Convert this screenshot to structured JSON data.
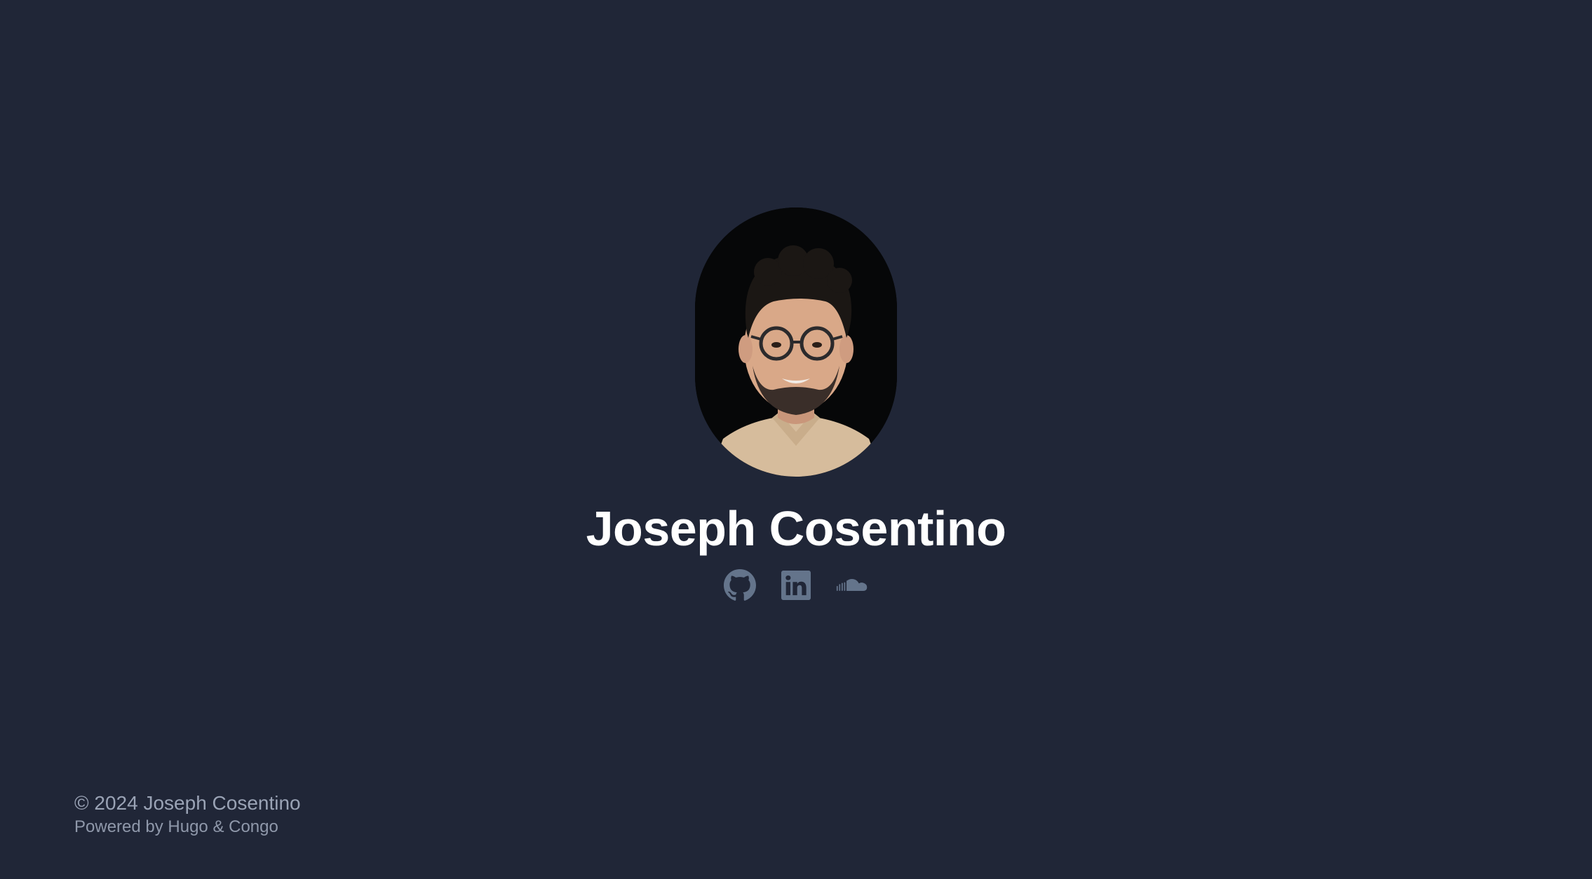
{
  "profile": {
    "name": "Joseph Cosentino",
    "avatar_alt": "Joseph Cosentino"
  },
  "social_links": [
    {
      "label": "GitHub",
      "icon": "github-icon"
    },
    {
      "label": "LinkedIn",
      "icon": "linkedin-icon"
    },
    {
      "label": "SoundCloud",
      "icon": "soundcloud-icon"
    }
  ],
  "footer": {
    "copyright": "© 2024 Joseph Cosentino",
    "powered_by": "Powered by Hugo & Congo"
  },
  "colors": {
    "background": "#202637",
    "name_text": "#ffffff",
    "icon": "#64748b",
    "footer_text": "#9aa3b5"
  }
}
